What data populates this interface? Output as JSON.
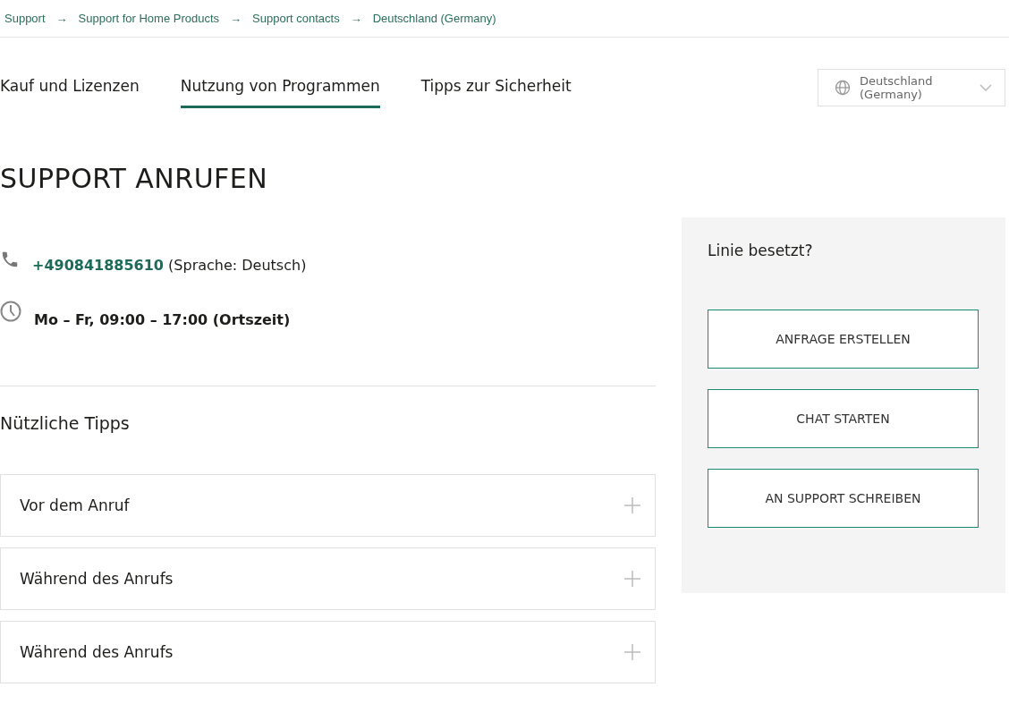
{
  "breadcrumbs": [
    "Support",
    "Support for Home Products",
    "Support contacts",
    "Deutschland (Germany)"
  ],
  "breadcrumb_separator": "→",
  "tabs": [
    {
      "label": "Kauf und Lizenzen",
      "selected": false
    },
    {
      "label": "Nutzung von Programmen",
      "selected": true
    },
    {
      "label": "Tipps zur Sicherheit",
      "selected": false
    }
  ],
  "region_select": {
    "value": "Deutschland (Germany)"
  },
  "heading": "SUPPORT ANRUFEN",
  "phone": {
    "number": "+490841885610",
    "note": "(Sprache: Deutsch)"
  },
  "hours": "Mo – Fr, 09:00 – 17:00 (Ortszeit)",
  "tips": {
    "title": "Nützliche Tipps",
    "items": [
      {
        "label": "Vor dem Anruf",
        "expanded": false
      },
      {
        "label": "Während des Anrufs",
        "expanded": false
      },
      {
        "label": "Während des Anrufs",
        "expanded": false
      }
    ]
  },
  "side_panel": {
    "title": "Linie besetzt?",
    "buttons": [
      "ANFRAGE ERSTELLEN",
      "CHAT STARTEN",
      "AN SUPPORT SCHREIBEN"
    ]
  }
}
